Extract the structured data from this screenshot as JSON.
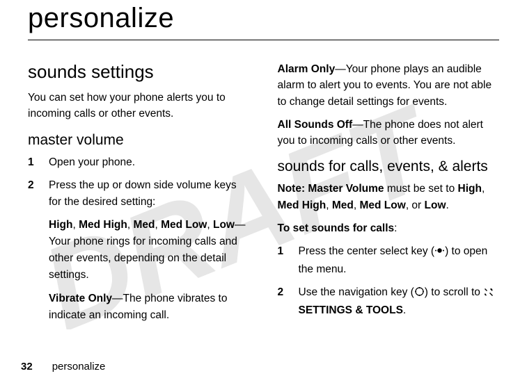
{
  "watermark": "DRAFT",
  "chapter_title": "personalize",
  "left": {
    "section_title": "sounds settings",
    "intro": "You can set how your phone alerts you to incoming calls or other events.",
    "sub1_title": "master volume",
    "step1": "Open your phone.",
    "step2": "Press the up or down side volume keys for the desired setting:",
    "levels_high": "High",
    "levels_medhigh": "Med High",
    "levels_med": "Med",
    "levels_medlow": "Med Low",
    "levels_low": "Low",
    "levels_desc": "—Your phone rings for incoming calls and other events, depending on the detail settings.",
    "vibrate_label": "Vibrate Only",
    "vibrate_desc": "—The phone vibrates to indicate an incoming call."
  },
  "right": {
    "alarm_label": "Alarm Only",
    "alarm_desc": "—Your phone plays an audible alarm to alert you to events. You are not able to change detail settings for events.",
    "alloff_label": "All Sounds Off",
    "alloff_desc": "—The phone does not alert you to incoming calls or other events.",
    "sub2_title": "sounds for calls, events, & alerts",
    "note_label": "Note:",
    "note_mv": "Master Volume",
    "note_mid": " must be set to ",
    "note_or": " or ",
    "note_end": ".",
    "to_set": "To set sounds for calls",
    "step1_a": "Press the center select key (",
    "step1_b": ") to open the menu.",
    "step2_a": "Use the navigation key (",
    "step2_b": ") to scroll to ",
    "settings_tools": "SETTINGS & TOOLS",
    "step2_c": "."
  },
  "footer": {
    "page": "32",
    "label": "personalize"
  }
}
